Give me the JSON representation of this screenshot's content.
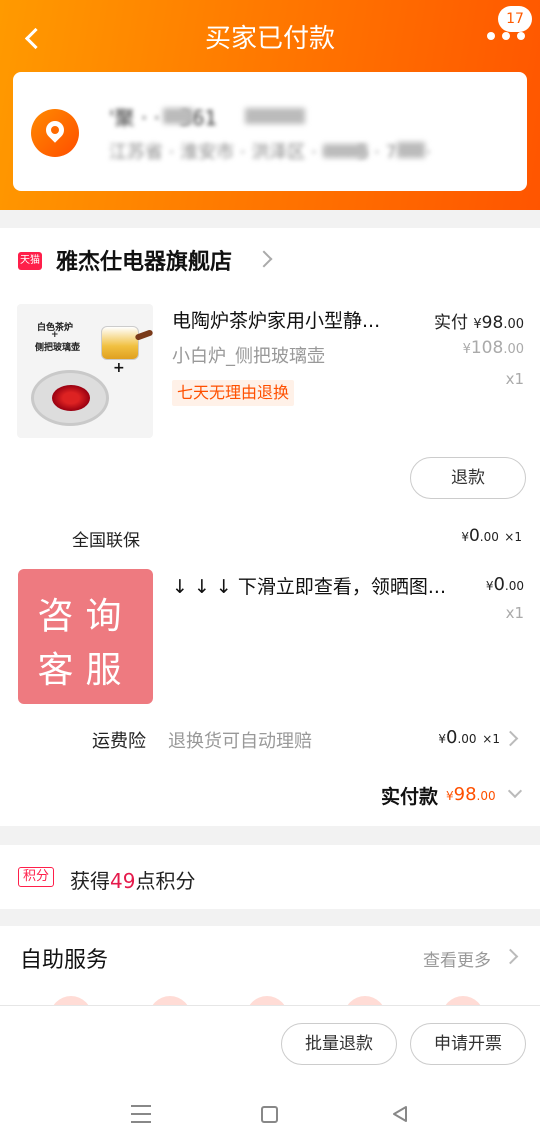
{
  "header": {
    "title": "买家已付款",
    "badge_count": "17"
  },
  "address": {
    "name_line": "'聚 · · · 361",
    "address_line": "江苏省 · 淮安市 · 洪泽区 · · · · 5 · 7 · · ·"
  },
  "shop": {
    "tmall_label": "天猫",
    "name": "雅杰仕电器旗舰店"
  },
  "product1": {
    "image_label_1": "白色茶炉",
    "image_label_2": "+",
    "image_label_3": "侧把玻璃壶",
    "title": "电陶炉茶炉家用小型静...",
    "spec": "小白炉_侧把玻璃壶",
    "tag": "七天无理由退换",
    "paid_label": "实付",
    "paid_currency": "¥",
    "paid_int": "98",
    "paid_dec": ".00",
    "orig_currency": "¥",
    "orig_int": "108",
    "orig_dec": ".00",
    "qty": "x1"
  },
  "refund_button": "退款",
  "warranty": {
    "label": "全国联保",
    "currency": "¥",
    "int": "0",
    "dec": ".00",
    "qty": "×1"
  },
  "product2": {
    "image_line1": "咨询",
    "image_line2": "客服",
    "title": "↓ ↓ ↓ 下滑立即查看，领晒图...",
    "currency": "¥",
    "int": "0",
    "dec": ".00",
    "qty": "x1"
  },
  "insurance": {
    "label": "运费险",
    "desc": "退换货可自动理赔",
    "currency": "¥",
    "int": "0",
    "dec": ".00",
    "qty": "×1"
  },
  "total": {
    "label": "实付款",
    "currency": "¥",
    "int": "98",
    "dec": ".00"
  },
  "points": {
    "badge": "积分",
    "prefix": "获得",
    "num": "49",
    "suffix": "点积分"
  },
  "self_service": {
    "title": "自助服务",
    "see_more": "查看更多"
  },
  "bottom_actions": {
    "batch_refund": "批量退款",
    "invoice": "申请开票"
  },
  "colors": {
    "accent_orange": "#ff5000",
    "header_start": "#ff9a00",
    "header_end": "#ff5500",
    "tmall_red": "#ff1f4a"
  }
}
